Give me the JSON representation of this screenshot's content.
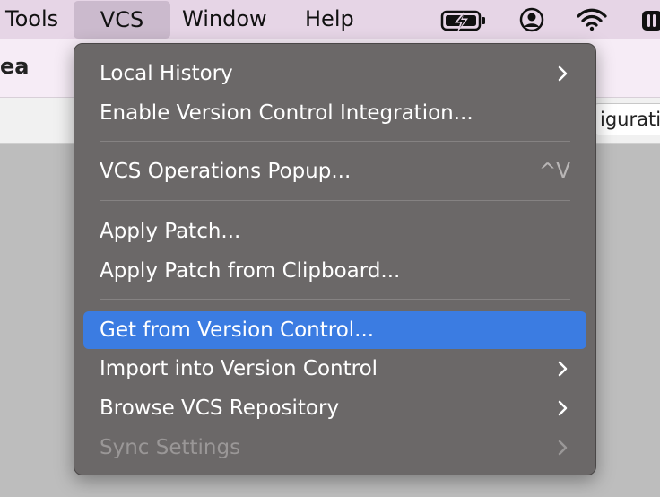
{
  "menubar": {
    "items": [
      "Tools",
      "VCS",
      "Window",
      "Help"
    ],
    "icons": [
      "battery-charging-icon",
      "user-account-icon",
      "wifi-icon",
      "control-center-icon"
    ]
  },
  "window": {
    "title_fragment": "ea",
    "toolbar_field_fragment": "iguration"
  },
  "menu": {
    "items": [
      {
        "label": "Local History",
        "submenu": true
      },
      {
        "label": "Enable Version Control Integration..."
      },
      {
        "label": "VCS Operations Popup...",
        "shortcut": "^V"
      },
      {
        "label": "Apply Patch..."
      },
      {
        "label": "Apply Patch from Clipboard..."
      },
      {
        "label": "Get from Version Control...",
        "selected": true
      },
      {
        "label": "Import into Version Control",
        "submenu": true
      },
      {
        "label": "Browse VCS Repository",
        "submenu": true
      },
      {
        "label": "Sync Settings",
        "submenu": true,
        "disabled": true
      }
    ]
  },
  "colors": {
    "menubar_bg": "#e6d5e6",
    "menu_bg": "#6b6868",
    "selection": "#3b7ce2",
    "disabled_text": "#9a9797"
  }
}
